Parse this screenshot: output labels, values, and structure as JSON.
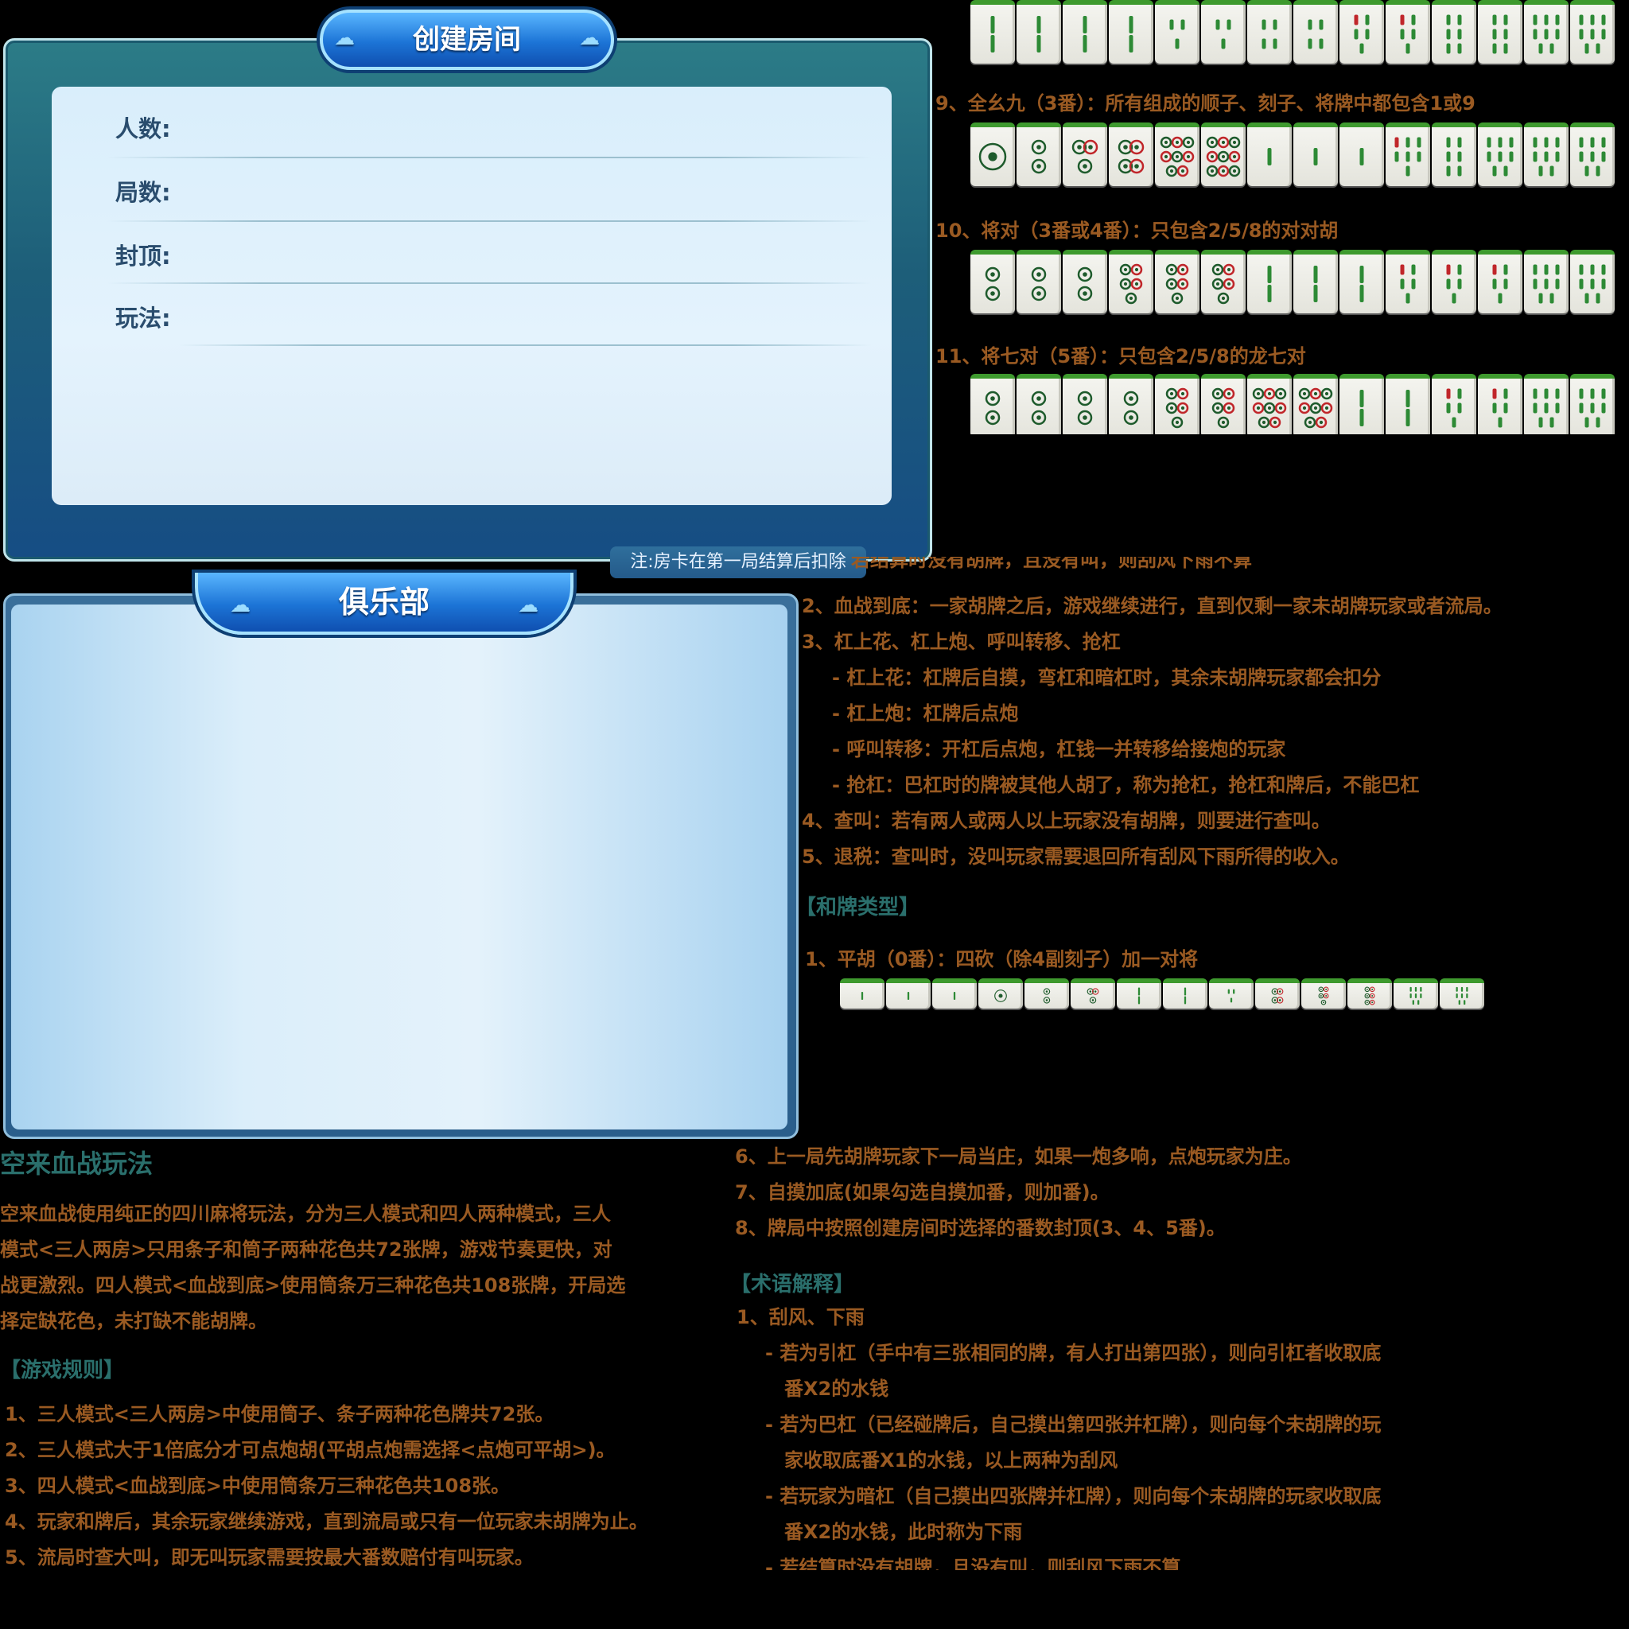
{
  "create_room": {
    "title": "创建房间",
    "fields": [
      {
        "label": "人数:"
      },
      {
        "label": "局数:"
      },
      {
        "label": "封顶:"
      },
      {
        "label": "玩法:"
      }
    ],
    "note": "注:房卡在第一局结算后扣除"
  },
  "club": {
    "title": "俱乐部"
  },
  "fan_types_top": [
    {
      "text": "9、全幺九（3番）：所有组成的顺子、刻子、将牌中都包含1或9"
    },
    {
      "text": "10、将对（3番或4番）：只包含2/5/8的对对胡"
    },
    {
      "text": "11、将七对（5番）：只包含2/5/8的龙七对"
    }
  ],
  "tile_rows": {
    "row0": [
      "b2",
      "b2",
      "b2",
      "b2",
      "b3",
      "b3",
      "b4",
      "b4",
      "b5",
      "b5",
      "b6",
      "b6",
      "b8",
      "b8"
    ],
    "row9": [
      "c1",
      "c2",
      "c3",
      "c4",
      "c8",
      "c9",
      "b1",
      "b1",
      "b1",
      "b7",
      "b6",
      "b8",
      "b8",
      "b8"
    ],
    "row10": [
      "c2",
      "c2",
      "c2",
      "c5",
      "c5",
      "c5",
      "b2",
      "b2",
      "b2",
      "b5",
      "b5",
      "b5",
      "b8",
      "b8"
    ],
    "row11": [
      "c2",
      "c2",
      "c2",
      "c2",
      "c5",
      "c5",
      "c8",
      "c8",
      "b2",
      "b2",
      "b5",
      "b5",
      "b8",
      "b8"
    ],
    "row_pinghu": [
      "b1",
      "b1",
      "b1",
      "c1",
      "c2",
      "c3",
      "b2",
      "b2",
      "b3",
      "c4",
      "c5",
      "c6",
      "b8",
      "b8"
    ]
  },
  "rules_right_top": {
    "partial_line": "若结算时没有胡牌，且没有叫，则刮风下雨不算",
    "lines": [
      "2、血战到底：一家胡牌之后，游戏继续进行，直到仅剩一家未胡牌玩家或者流局。",
      "3、杠上花、杠上炮、呼叫转移、抢杠",
      "- 杠上花：杠牌后自摸，弯杠和暗杠时，其余未胡牌玩家都会扣分",
      "- 杠上炮：杠牌后点炮",
      "- 呼叫转移：开杠后点炮，杠钱一并转移给接炮的玩家",
      "- 抢杠：巴杠时的牌被其他人胡了，称为抢杠，抢杠和牌后，不能巴杠",
      "4、查叫：若有两人或两人以上玩家没有胡牌，则要进行查叫。",
      "5、退税：查叫时，没叫玩家需要退回所有刮风下雨所得的收入。"
    ],
    "section": "【和牌类型】",
    "pinghu": "1、平胡（0番）：四砍（除4副刻子）加一对将"
  },
  "rules_left": {
    "title": "空来血战玩法",
    "intro": [
      "空来血战使用纯正的四川麻将玩法，分为三人模式和四人两种模式，三人",
      "模式<三人两房>只用条子和筒子两种花色共72张牌，游戏节奏更快，对",
      "战更激烈。四人模式<血战到底>使用筒条万三种花色共108张牌，开局选",
      "择定缺花色，未打缺不能胡牌。"
    ],
    "section": "【游戏规则】",
    "lines": [
      "1、三人模式<三人两房>中使用筒子、条子两种花色牌共72张。",
      "2、三人模式大于1倍底分才可点炮胡(平胡点炮需选择<点炮可平胡>)。",
      "3、四人模式<血战到底>中使用筒条万三种花色共108张。",
      "4、玩家和牌后，其余玩家继续游戏，直到流局或只有一位玩家未胡牌为止。",
      "5、流局时查大叫，即无叫玩家需要按最大番数赔付有叫玩家。"
    ]
  },
  "rules_right_bottom": {
    "lines": [
      "6、上一局先胡牌玩家下一局当庄，如果一炮多响，点炮玩家为庄。",
      "7、自摸加底(如果勾选自摸加番，则加番)。",
      "8、牌局中按照创建房间时选择的番数封顶(3、4、5番)。"
    ],
    "section": "【术语解释】",
    "terms": [
      "1、刮风、下雨",
      "- 若为引杠（手中有三张相同的牌，有人打出第四张），则向引杠者收取底",
      "番X2的水钱",
      "- 若为巴杠（已经碰牌后，自己摸出第四张并杠牌），则向每个未胡牌的玩",
      "家收取底番X1的水钱，以上两种为刮风",
      "- 若玩家为暗杠（自己摸出四张牌并杠牌），则向每个未胡牌的玩家收取底",
      "番X2的水钱，此时称为下雨",
      "- 若结算时没有胡牌，且没有叫，则刮风下雨不算"
    ]
  },
  "colors": {
    "rule_text": "#9a5a22",
    "section_text": "#2a6f6c",
    "panel_teal": "#2c7c87",
    "tile_green": "#3e9a2e"
  }
}
